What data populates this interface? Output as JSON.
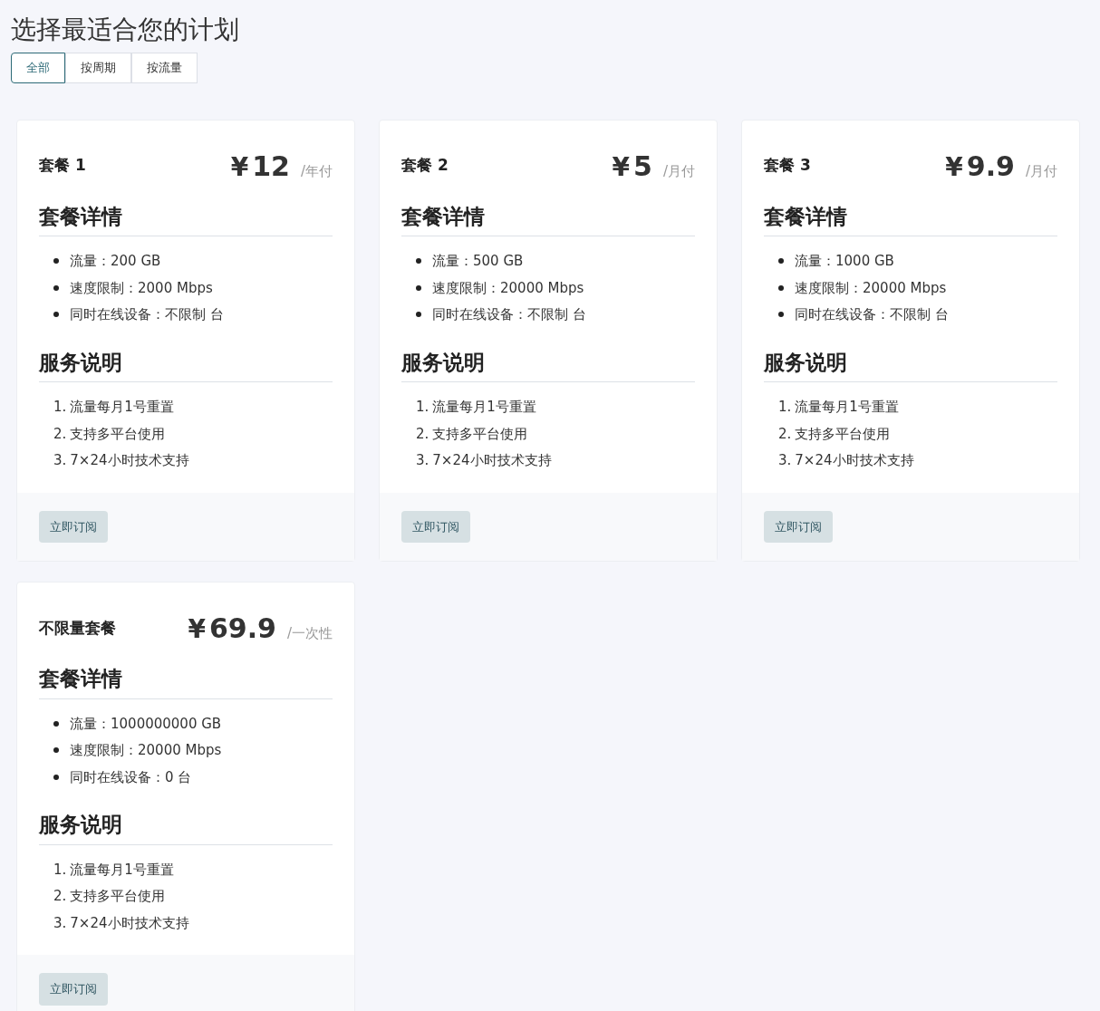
{
  "title": "选择最适合您的计划",
  "tabs": [
    {
      "label": "全部",
      "selected": true
    },
    {
      "label": "按周期",
      "selected": false
    },
    {
      "label": "按流量",
      "selected": false
    }
  ],
  "plans": [
    {
      "name": "套餐 1",
      "currency": "¥",
      "price": "12",
      "period": "/年付",
      "details_heading": "套餐详情",
      "details": [
        "流量：200 GB",
        "速度限制：2000 Mbps",
        "同时在线设备：不限制 台"
      ],
      "service_heading": "服务说明",
      "services": [
        {
          "number": "1.",
          "text": "流量每月1号重置"
        },
        {
          "number": "2.",
          "text": "支持多平台使用"
        },
        {
          "number": "3.",
          "text": "7×24小时技术支持"
        }
      ],
      "button": "立即订阅"
    },
    {
      "name": "套餐 2",
      "currency": "¥",
      "price": "5",
      "period": "/月付",
      "details_heading": "套餐详情",
      "details": [
        "流量：500 GB",
        "速度限制：20000 Mbps",
        "同时在线设备：不限制 台"
      ],
      "service_heading": "服务说明",
      "services": [
        {
          "number": "1.",
          "text": "流量每月1号重置"
        },
        {
          "number": "2.",
          "text": "支持多平台使用"
        },
        {
          "number": "3.",
          "text": "7×24小时技术支持"
        }
      ],
      "button": "立即订阅"
    },
    {
      "name": "套餐 3",
      "currency": "¥",
      "price": "9.9",
      "period": "/月付",
      "details_heading": "套餐详情",
      "details": [
        "流量：1000 GB",
        "速度限制：20000 Mbps",
        "同时在线设备：不限制 台"
      ],
      "service_heading": "服务说明",
      "services": [
        {
          "number": "1.",
          "text": "流量每月1号重置"
        },
        {
          "number": "2.",
          "text": "支持多平台使用"
        },
        {
          "number": "3.",
          "text": "7×24小时技术支持"
        }
      ],
      "button": "立即订阅"
    },
    {
      "name": "不限量套餐",
      "currency": "¥",
      "price": "69.9",
      "period": "/一次性",
      "details_heading": "套餐详情",
      "details": [
        "流量：1000000000 GB",
        "速度限制：20000 Mbps",
        "同时在线设备：0 台"
      ],
      "service_heading": "服务说明",
      "services": [
        {
          "number": "1.",
          "text": "流量每月1号重置"
        },
        {
          "number": "2.",
          "text": "支持多平台使用"
        },
        {
          "number": "3.",
          "text": "7×24小时技术支持"
        }
      ],
      "button": "立即订阅"
    }
  ]
}
